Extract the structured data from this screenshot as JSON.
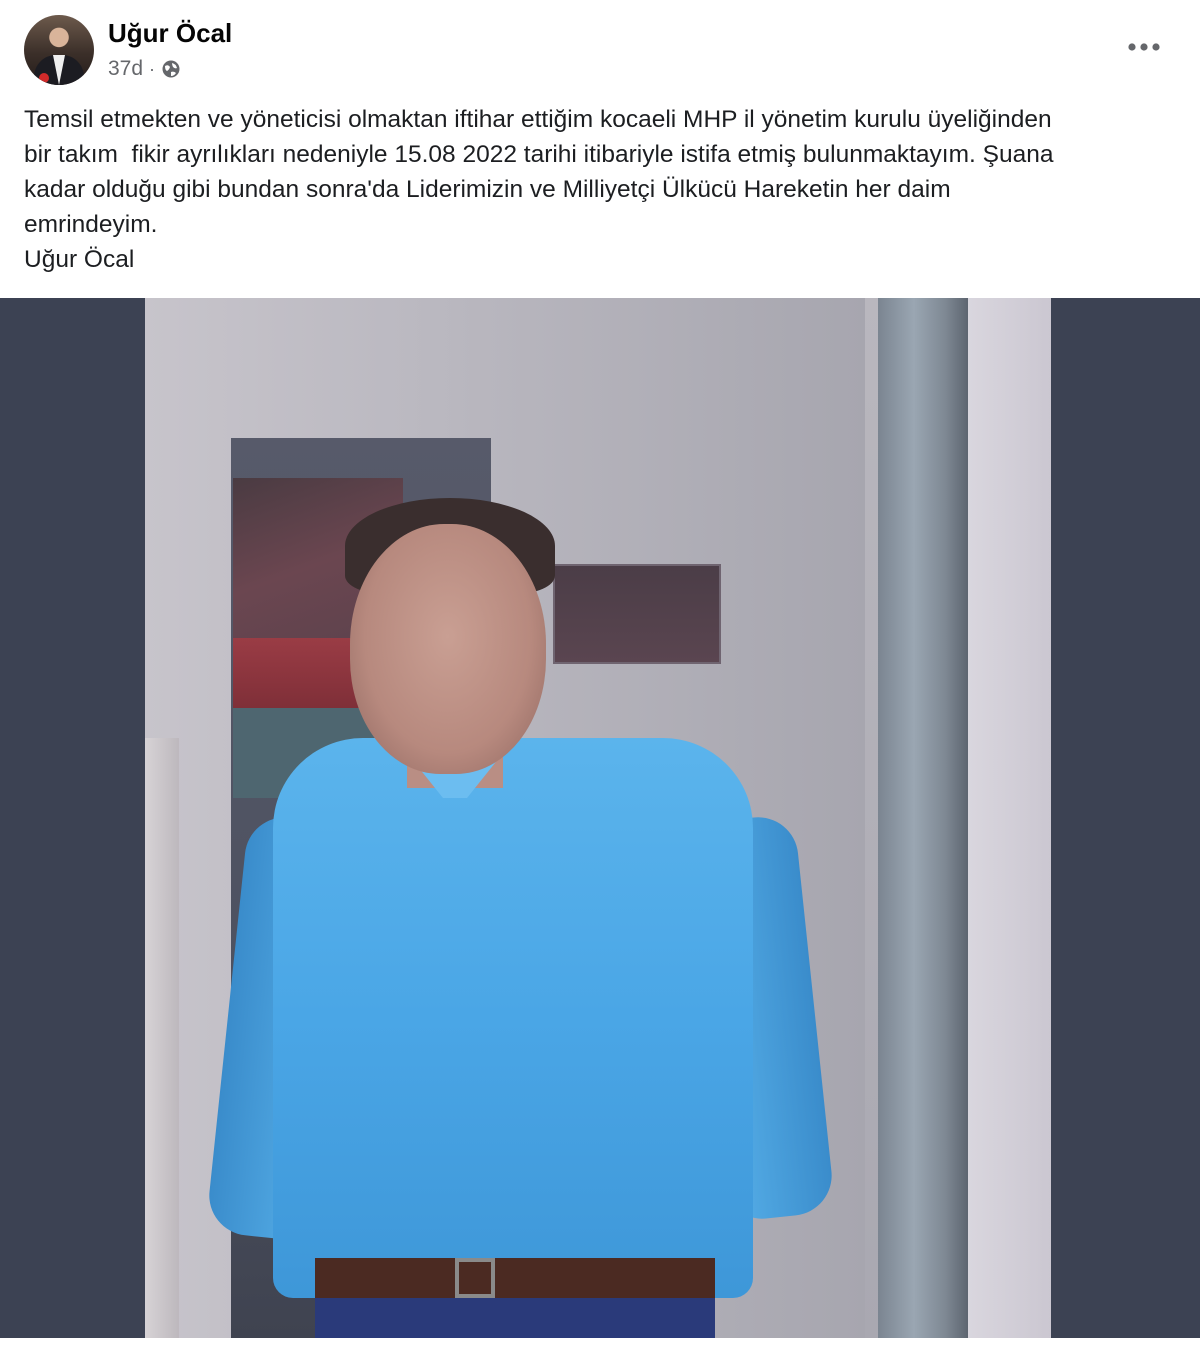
{
  "post": {
    "author": "Uğur Öcal",
    "timestamp": "37d",
    "separator": "·",
    "privacy_icon": "globe-icon",
    "more_icon": "more-options-icon",
    "text_lines": [
      "Temsil etmekten ve yöneticisi olmaktan iftihar ettiğim kocaeli MHP il yönetim kurulu üyeliğinden",
      "bir takım  fikir ayrılıkları nedeniyle 15.08 2022 tarihi itibariyle istifa etmiş bulunmaktayım. Şuana",
      "kadar olduğu gibi bundan sonra'da Liderimizin ve Milliyetçi Ülkücü Hareketin her daim",
      "emrindeyim.",
      "Uğur Öcal"
    ]
  },
  "colors": {
    "secondary_text": "#65676b",
    "photo_background": "#3c4253"
  }
}
